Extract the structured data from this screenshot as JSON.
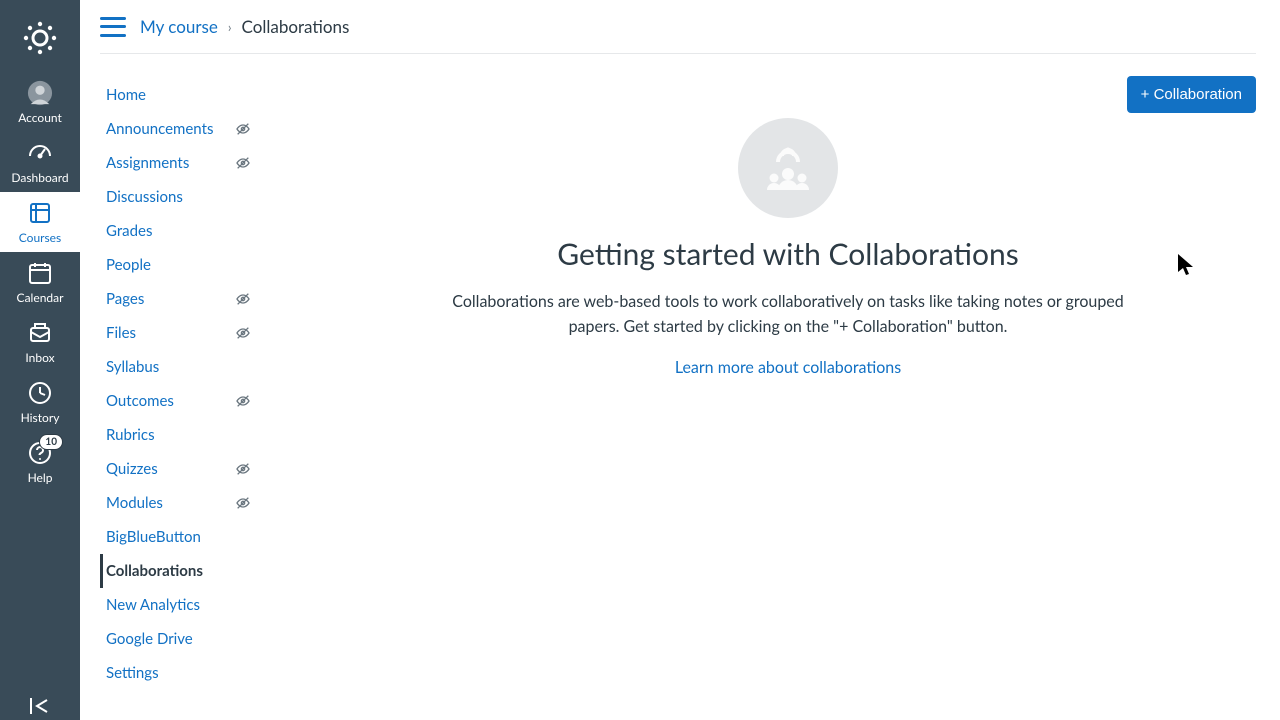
{
  "rail": {
    "items": [
      {
        "key": "account",
        "label": "Account"
      },
      {
        "key": "dashboard",
        "label": "Dashboard"
      },
      {
        "key": "courses",
        "label": "Courses"
      },
      {
        "key": "calendar",
        "label": "Calendar"
      },
      {
        "key": "inbox",
        "label": "Inbox"
      },
      {
        "key": "history",
        "label": "History"
      },
      {
        "key": "help",
        "label": "Help",
        "badge": "10"
      }
    ]
  },
  "breadcrumb": {
    "course": "My course",
    "page": "Collaborations"
  },
  "coursenav": {
    "items": [
      {
        "label": "Home",
        "hidden": false,
        "active": false
      },
      {
        "label": "Announcements",
        "hidden": true,
        "active": false
      },
      {
        "label": "Assignments",
        "hidden": true,
        "active": false
      },
      {
        "label": "Discussions",
        "hidden": false,
        "active": false
      },
      {
        "label": "Grades",
        "hidden": false,
        "active": false
      },
      {
        "label": "People",
        "hidden": false,
        "active": false
      },
      {
        "label": "Pages",
        "hidden": true,
        "active": false
      },
      {
        "label": "Files",
        "hidden": true,
        "active": false
      },
      {
        "label": "Syllabus",
        "hidden": false,
        "active": false
      },
      {
        "label": "Outcomes",
        "hidden": true,
        "active": false
      },
      {
        "label": "Rubrics",
        "hidden": false,
        "active": false
      },
      {
        "label": "Quizzes",
        "hidden": true,
        "active": false
      },
      {
        "label": "Modules",
        "hidden": true,
        "active": false
      },
      {
        "label": "BigBlueButton",
        "hidden": false,
        "active": false
      },
      {
        "label": "Collaborations",
        "hidden": false,
        "active": true
      },
      {
        "label": "New Analytics",
        "hidden": false,
        "active": false
      },
      {
        "label": "Google Drive",
        "hidden": false,
        "active": false
      },
      {
        "label": "Settings",
        "hidden": false,
        "active": false
      }
    ]
  },
  "main": {
    "add_button": "+ Collaboration",
    "title": "Getting started with Collaborations",
    "description": "Collaborations are web-based tools to work collaboratively on tasks like taking notes or grouped papers. Get started by clicking on the \"+ Collaboration\" button.",
    "learn_more": "Learn more about collaborations"
  }
}
